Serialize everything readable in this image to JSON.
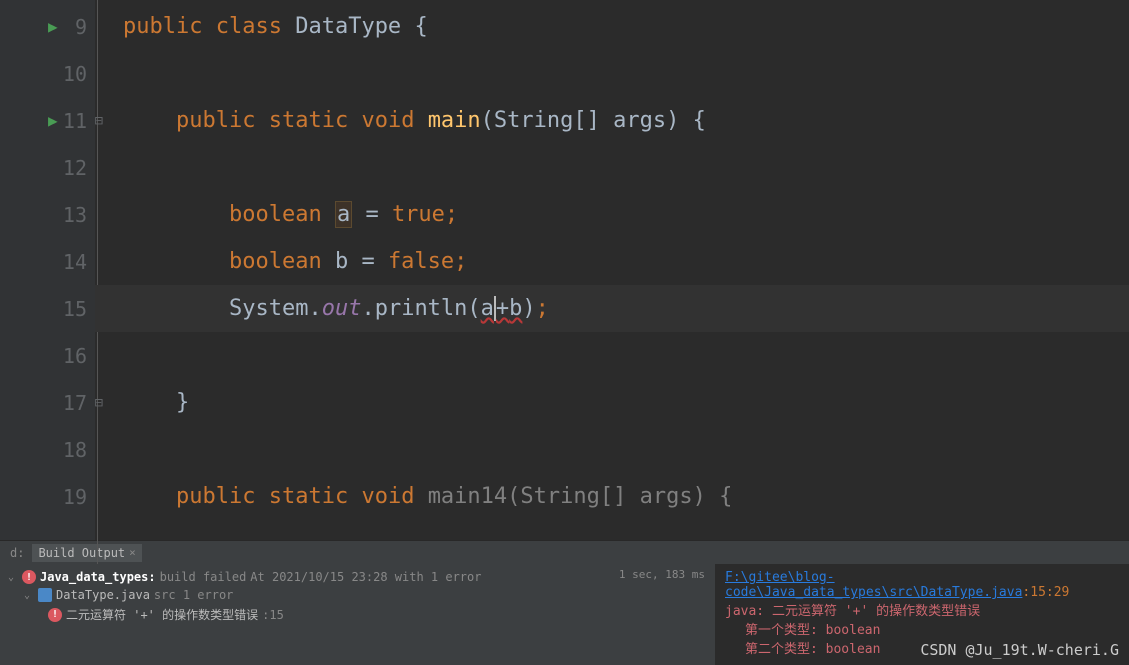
{
  "editor": {
    "line_numbers": [
      "9",
      "10",
      "11",
      "12",
      "13",
      "14",
      "15",
      "16",
      "17",
      "18",
      "19"
    ],
    "run_lines": [
      0,
      2
    ],
    "fold_lines": [
      0,
      2,
      8
    ],
    "highlighted_line": 6,
    "code": {
      "line9": {
        "kw1": "public",
        "kw2": "class",
        "cls": "DataType",
        "brace": "{"
      },
      "line11": {
        "kw1": "public",
        "kw2": "static",
        "kw3": "void",
        "method": "main",
        "params": "(String[] args) {"
      },
      "line13": {
        "type": "boolean",
        "var": "a",
        "eq": "=",
        "val": "true",
        "semi": ";"
      },
      "line14": {
        "type": "boolean",
        "var": "b",
        "eq": "=",
        "val": "false",
        "semi": ";"
      },
      "line15": {
        "cls": "System",
        "dot1": ".",
        "field": "out",
        "dot2": ".",
        "method": "println",
        "open": "(",
        "arg1": "a",
        "plus": "+",
        "arg2": "b",
        "close": ")",
        "semi": ";"
      },
      "line17": {
        "brace": "}"
      },
      "line19": {
        "kw1": "public",
        "kw2": "static",
        "kw3": "void",
        "method": "main14",
        "params": "(String[] args) {"
      }
    }
  },
  "bottom": {
    "tab_prefix": "d:",
    "tab_name": "Build Output",
    "time": "1 sec, 183 ms",
    "tree": {
      "root": {
        "name": "Java_data_types:",
        "status": "build failed",
        "meta": "At 2021/10/15 23:28 with 1 error"
      },
      "file": {
        "name": "DataType.java",
        "meta": "src 1 error"
      },
      "error": {
        "msg": "二元运算符 '+' 的操作数类型错误",
        "line": ":15"
      }
    },
    "console": {
      "path": "F:\\gitee\\blog-code\\Java_data_types\\src\\DataType.java",
      "linecol": ":15:29",
      "err1": "java: 二元运算符 '+' 的操作数类型错误",
      "err2": "第一个类型:  boolean",
      "err3": "第二个类型:  boolean"
    }
  },
  "watermark": "CSDN @Ju_19t.W-cheri.G"
}
